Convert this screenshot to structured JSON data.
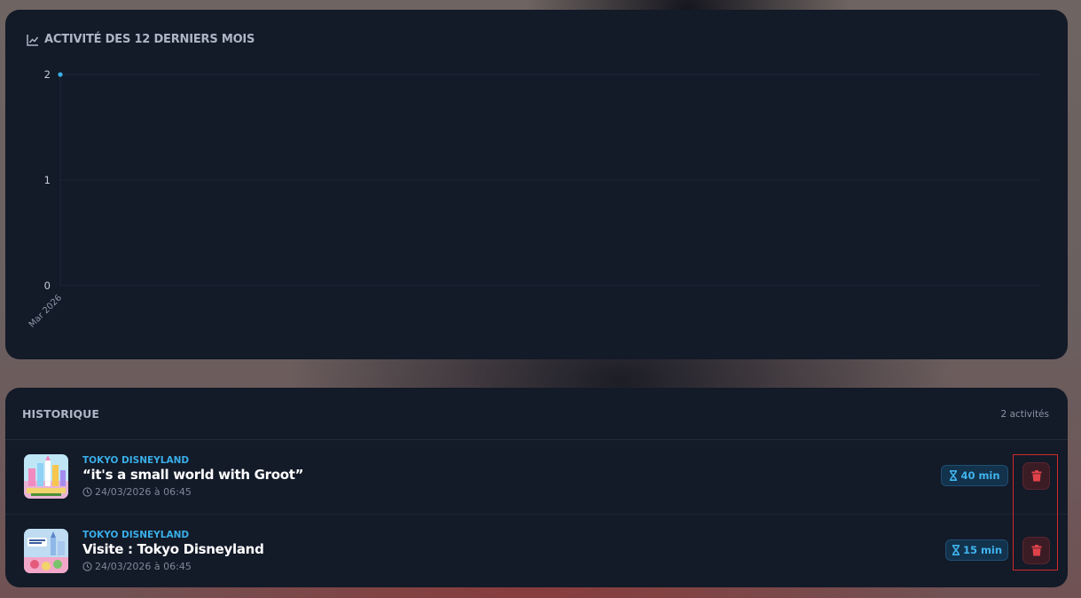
{
  "chart_card": {
    "title": "ACTIVITÉ DES 12 DERNIERS MOIS",
    "icon": "line-chart-icon"
  },
  "chart_data": {
    "type": "line",
    "categories": [
      "Mar 2026"
    ],
    "series": [
      {
        "values": [
          2
        ]
      }
    ],
    "yticks": [
      0,
      1,
      2
    ],
    "ylim": [
      0,
      2
    ],
    "grid": true,
    "colors": {
      "point": "#3aaee8",
      "grid": "#1e2738",
      "ticks": "#c7ccd6",
      "xlabel": "#8b94a5"
    }
  },
  "history": {
    "title": "HISTORIQUE",
    "count": "2 activités",
    "items": [
      {
        "park": "TOKYO DISNEYLAND",
        "name": "“it's a small world with Groot”",
        "date": "24/03/2026 à 06:45",
        "duration": "40 min",
        "thumb_icon": "small-world-attraction-image"
      },
      {
        "park": "TOKYO DISNEYLAND",
        "name": "Visite : Tokyo Disneyland",
        "date": "24/03/2026 à 06:45",
        "duration": "15 min",
        "thumb_icon": "tokyo-disney-resort-image"
      }
    ]
  },
  "colors": {
    "accent": "#3aaee8",
    "danger": "#e0424a",
    "card": "#131a28"
  }
}
